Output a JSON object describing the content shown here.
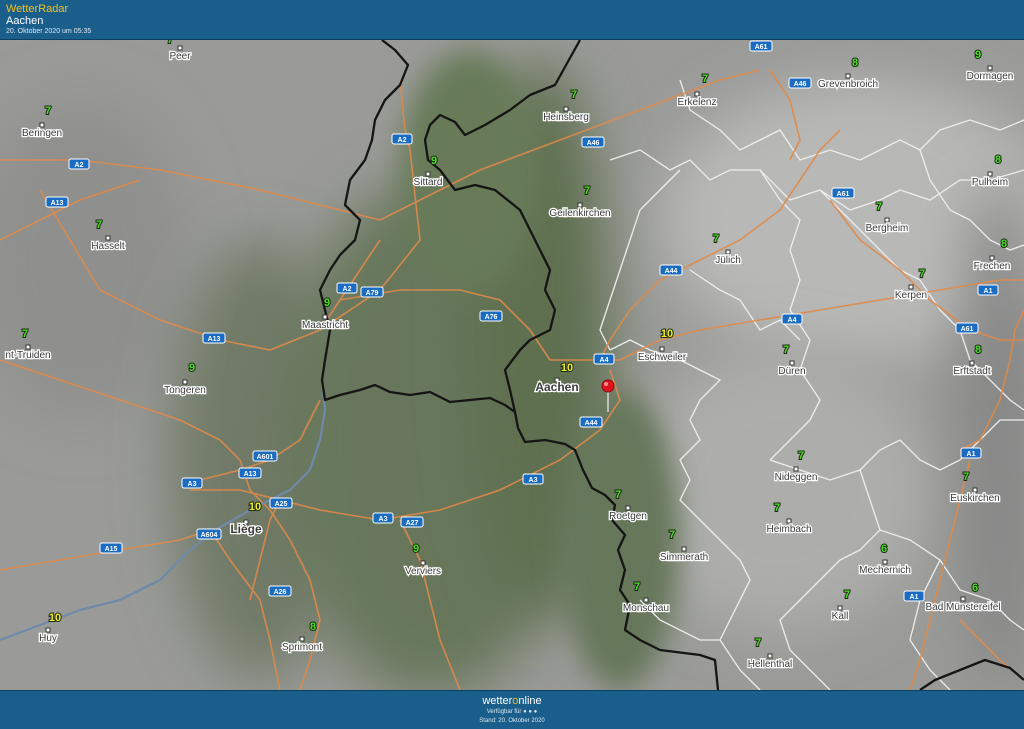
{
  "header": {
    "brand": "WetterRadar",
    "location": "Aachen",
    "timestamp": "20. Oktober 2020 um 05:35"
  },
  "footer": {
    "logo_prefix": "wetter",
    "logo_o": "o",
    "logo_suffix": "nline",
    "available": "Verfügbar für",
    "stand": "Stand: 20. Oktober 2020"
  },
  "colors": {
    "bar": "#1a5e8c",
    "brand_accent": "#f2c21b",
    "temp_green": "#4cdc2a",
    "temp_yellow": "#f0ea2a",
    "road": "#e08a4a",
    "border": "#151515",
    "pin": "#e0141e"
  },
  "roads": [
    "A61",
    "A46",
    "A2",
    "A46",
    "A61",
    "A2",
    "A13",
    "A44",
    "A79",
    "A2",
    "A76",
    "A1",
    "A4",
    "A13",
    "A4",
    "A61",
    "A4",
    "A44",
    "A1",
    "A601",
    "A13",
    "A3",
    "A3",
    "A25",
    "A3",
    "A27",
    "A604",
    "A15",
    "A26",
    "A1"
  ],
  "cities": [
    {
      "name": "Peer",
      "temp": "7",
      "tc": "green"
    },
    {
      "name": "Beringen",
      "temp": "7",
      "tc": "green"
    },
    {
      "name": "Hasselt",
      "temp": "7",
      "tc": "green"
    },
    {
      "name": "nt-Truiden",
      "temp": "7",
      "tc": "green"
    },
    {
      "name": "Tongeren",
      "temp": "9",
      "tc": "green"
    },
    {
      "name": "Maastricht",
      "temp": "9",
      "tc": "green"
    },
    {
      "name": "Sittard",
      "temp": "9",
      "tc": "green"
    },
    {
      "name": "Heinsberg",
      "temp": "7",
      "tc": "green"
    },
    {
      "name": "Erkelenz",
      "temp": "7",
      "tc": "green"
    },
    {
      "name": "Grevenbroich",
      "temp": "8",
      "tc": "green"
    },
    {
      "name": "Dormagen",
      "temp": "9",
      "tc": "green"
    },
    {
      "name": "Geilenkirchen",
      "temp": "7",
      "tc": "green"
    },
    {
      "name": "Jülich",
      "temp": "7",
      "tc": "green"
    },
    {
      "name": "Bergheim",
      "temp": "7",
      "tc": "green"
    },
    {
      "name": "Pulheim",
      "temp": "8",
      "tc": "green"
    },
    {
      "name": "Frechen",
      "temp": "8",
      "tc": "green"
    },
    {
      "name": "Kerpen",
      "temp": "7",
      "tc": "green"
    },
    {
      "name": "Eschweiler",
      "temp": "10",
      "tc": "yellow"
    },
    {
      "name": "Aachen",
      "temp": "10",
      "tc": "yellow"
    },
    {
      "name": "Düren",
      "temp": "7",
      "tc": "green"
    },
    {
      "name": "Erftstadt",
      "temp": "8",
      "tc": "green"
    },
    {
      "name": "Liège",
      "temp": "10",
      "tc": "yellow"
    },
    {
      "name": "Verviers",
      "temp": "9",
      "tc": "green"
    },
    {
      "name": "Roetgen",
      "temp": "7",
      "tc": "green"
    },
    {
      "name": "Nideggen",
      "temp": "7",
      "tc": "green"
    },
    {
      "name": "Euskirchen",
      "temp": "7",
      "tc": "green"
    },
    {
      "name": "Simmerath",
      "temp": "7",
      "tc": "green"
    },
    {
      "name": "Heimbach",
      "temp": "7",
      "tc": "green"
    },
    {
      "name": "Mechernich",
      "temp": "6",
      "tc": "green"
    },
    {
      "name": "Monschau",
      "temp": "7",
      "tc": "green"
    },
    {
      "name": "Kall",
      "temp": "7",
      "tc": "green"
    },
    {
      "name": "Bad Münstereifel",
      "temp": "6",
      "tc": "green"
    },
    {
      "name": "Huy",
      "temp": "10",
      "tc": "yellow"
    },
    {
      "name": "Sprimont",
      "temp": "8",
      "tc": "green"
    },
    {
      "name": "Hellenthal",
      "temp": "7",
      "tc": "green"
    }
  ]
}
